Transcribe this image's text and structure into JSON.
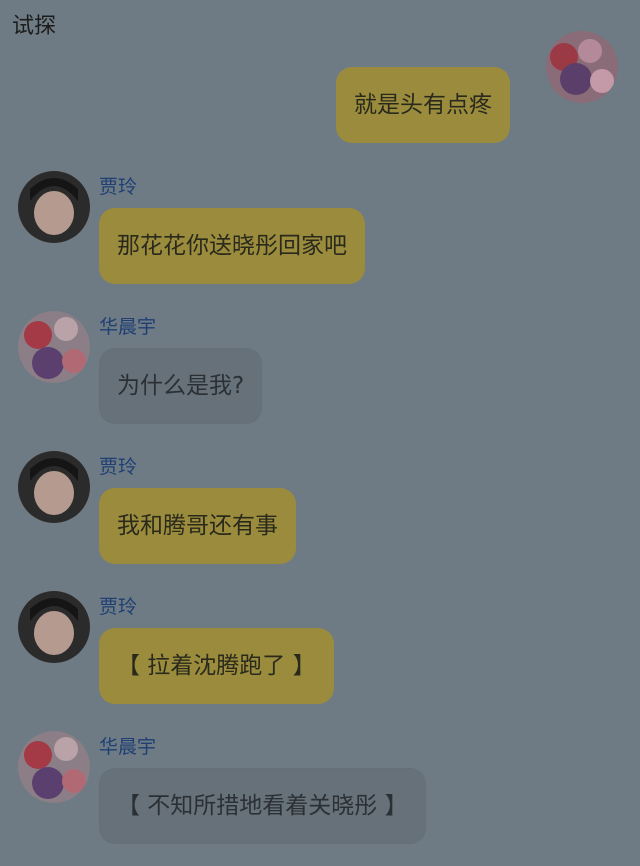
{
  "header": {
    "title": "试探"
  },
  "self_message": {
    "text": "就是头有点疼"
  },
  "messages": [
    {
      "sender": "贾玲",
      "text": "那花花你送晓彤回家吧"
    },
    {
      "sender": "华晨宇",
      "text": "为什么是我?"
    },
    {
      "sender": "贾玲",
      "text": "我和腾哥还有事"
    },
    {
      "sender": "贾玲",
      "text": "【 拉着沈腾跑了 】"
    },
    {
      "sender": "华晨宇",
      "text": "【 不知所措地看着关晓彤 】"
    }
  ],
  "colors": {
    "background": "#6e7b84",
    "bubble_yellow": "#9b8c3d",
    "bubble_grey": "#6a757e",
    "sender_name": "#1f3f73"
  }
}
